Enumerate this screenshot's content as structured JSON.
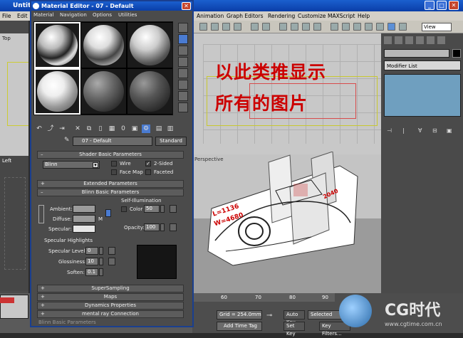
{
  "max_window": {
    "title": "Untit",
    "menu": [
      "File",
      "Edit",
      "Animation",
      "Graph Editors",
      "Rendering",
      "Customize",
      "MAXScript",
      "Help"
    ],
    "view_dropdown": "View"
  },
  "viewports": {
    "top_label": "Top",
    "left_label": "Left",
    "persp_label": "Perspective"
  },
  "command_panel": {
    "modifier_list": "Modifier List"
  },
  "overlay_text": {
    "line1": "以此类推显示",
    "line2": "所有的图片"
  },
  "material_editor": {
    "title": "Material Editor - 07 - Default",
    "menu": [
      "Material",
      "Navigation",
      "Options",
      "Utilities"
    ],
    "material_name": "07 - Default",
    "material_type": "Standard",
    "shader_rollup": "Shader Basic Parameters",
    "shader": "Blinn",
    "wire_label": "Wire",
    "two_sided_label": "2-Sided",
    "two_sided_checked": true,
    "face_map_label": "Face Map",
    "faceted_label": "Faceted",
    "extended_rollup": "Extended Parameters",
    "blinn_rollup": "Blinn Basic Parameters",
    "self_illum_label": "Self-Illumination",
    "color_label": "Color",
    "color_value": "50",
    "ambient_label": "Ambient:",
    "diffuse_label": "Diffuse:",
    "specular_label": "Specular:",
    "map_button": "M",
    "opacity_label": "Opacity:",
    "opacity_value": "100",
    "spec_highlights_label": "Specular Highlights",
    "spec_level_label": "Specular Level:",
    "spec_level_value": "0",
    "glossiness_label": "Glossiness:",
    "glossiness_value": "10",
    "soften_label": "Soften:",
    "soften_value": "0.1",
    "rollups_bottom": [
      "SuperSampling",
      "Maps",
      "Dynamics Properties",
      "mental ray Connection"
    ],
    "bottom_text": "Blinn Basic Parameters"
  },
  "car_labels": {
    "l": "L=1136",
    "w": "W=4680",
    "h": "2040"
  },
  "bottom_bar": {
    "ticks": [
      "60",
      "70",
      "80",
      "90"
    ],
    "grid": "Grid = 254.0mm",
    "add_time_tag": "Add Time Tag",
    "auto_key": "Auto Key",
    "set_key": "Set Key",
    "selected": "Selected",
    "key_filters": "Key Filters..."
  },
  "watermark": {
    "brand": "CG时代",
    "url": "www.cgtime.com.cn"
  },
  "colors": {
    "title_blue": "#0a3ea8",
    "accent_red": "#cc0000",
    "stack_blue": "#6f9fbf"
  }
}
